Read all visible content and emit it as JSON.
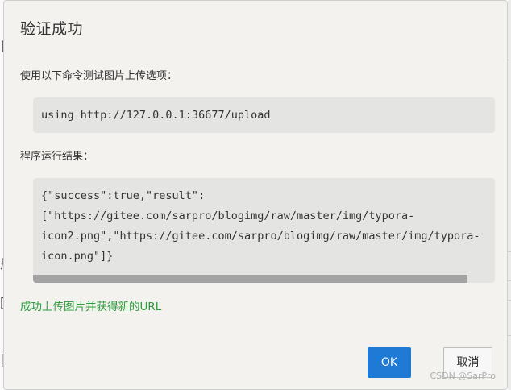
{
  "background": {
    "left_chars": [
      "目",
      "册",
      "[",
      "|"
    ]
  },
  "dialog": {
    "title": "验证成功",
    "command_label": "使用以下命令测试图片上传选项：",
    "command": "using http://127.0.0.1:36677/upload",
    "result_label": "程序运行结果：",
    "result_lines": [
      "{\"success\":true,\"result\":",
      "[\"https://gitee.com/sarpro/blogimg/raw/master/img/typora-",
      "icon2.png\",\"https://gitee.com/sarpro/blogimg/raw/master/img/typora-",
      "icon.png\"]}"
    ],
    "result_scroll_fraction": 0.94,
    "success_message": "成功上传图片并获得新的URL",
    "ok_label": "OK",
    "cancel_label": "取消",
    "colors": {
      "success": "#2a9d3a",
      "primary_button": "#1f7ad6"
    }
  },
  "watermark": "CSDN @SarPro"
}
